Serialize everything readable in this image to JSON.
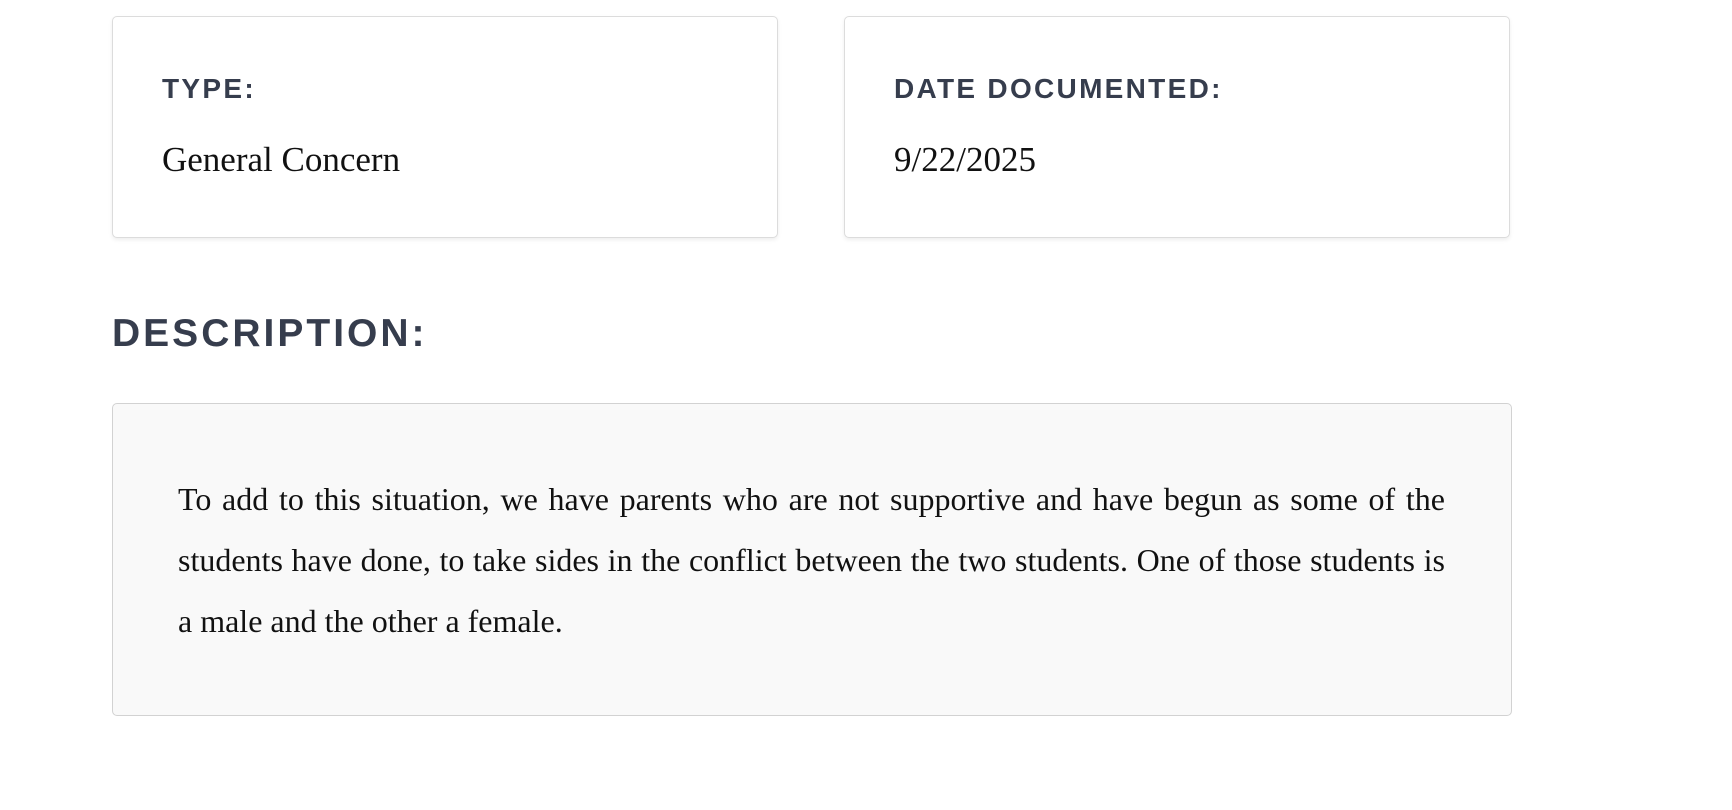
{
  "type_card": {
    "label": "TYPE:",
    "value": "General Concern"
  },
  "date_card": {
    "label": "DATE DOCUMENTED:",
    "value": "9/22/2025"
  },
  "description": {
    "heading": "DESCRIPTION:",
    "text": "To add to this situation, we have parents who are not supportive and have begun as some of the students have done, to take sides in the conflict between the two students. One of those students is a male and the other a female."
  },
  "colors": {
    "heading_text": "#363d4d",
    "body_text": "#111111",
    "card_border": "#dcdcdc",
    "description_background": "#f9f9f9"
  }
}
